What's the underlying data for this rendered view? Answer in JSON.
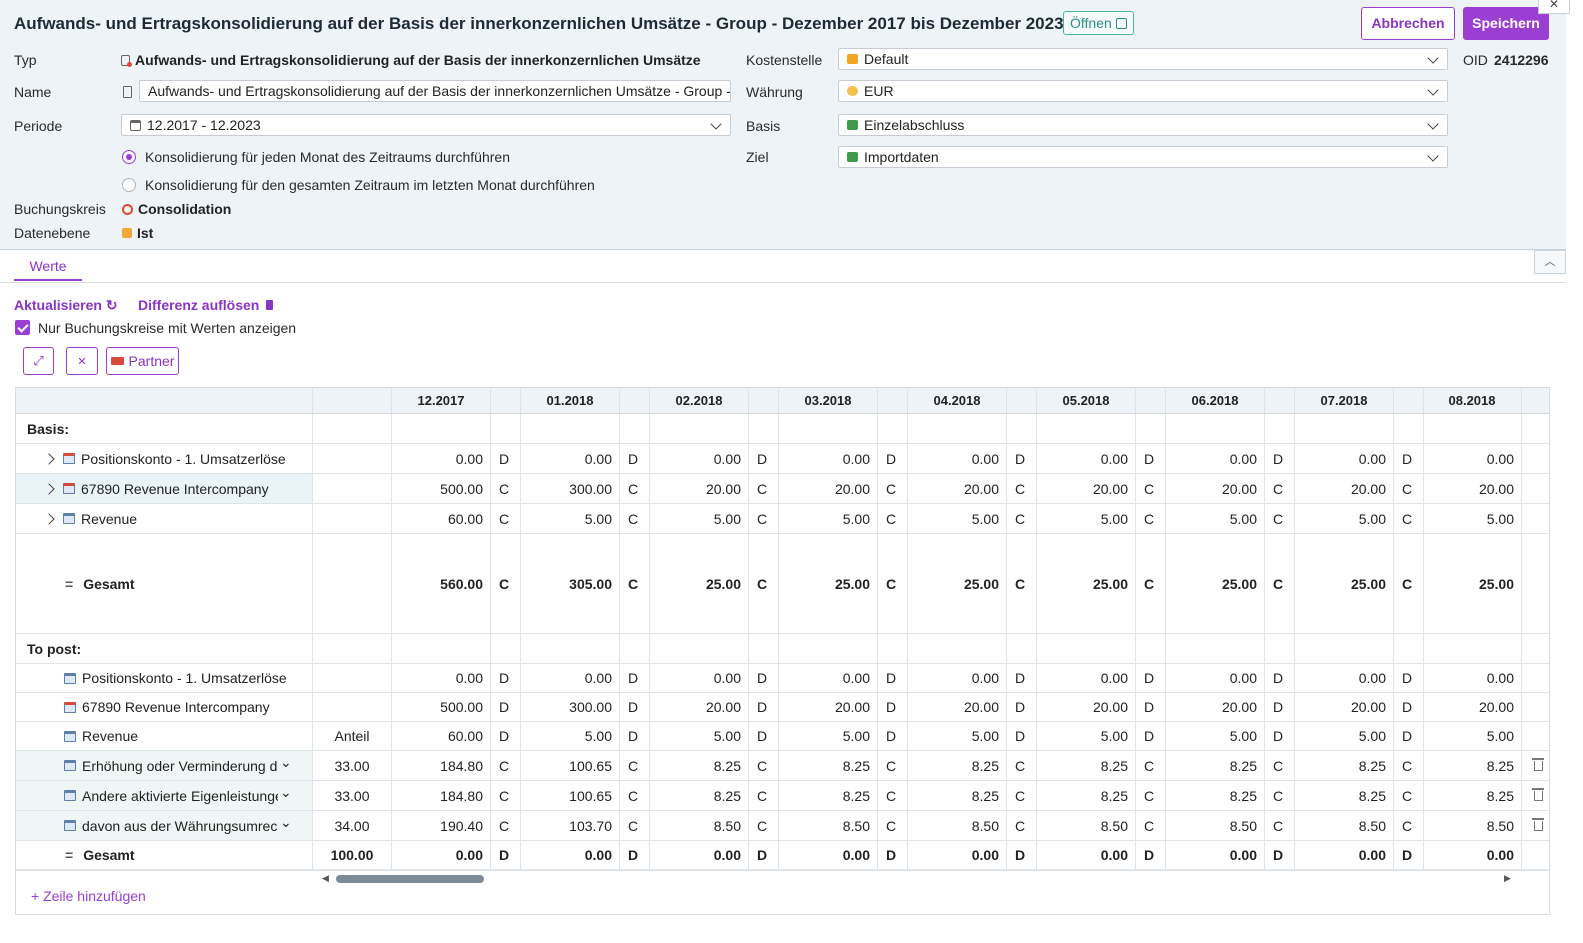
{
  "header": {
    "title": "Aufwands- und Ertragskonsolidierung auf der Basis der innerkonzernlichen Umsätze - Group - Dezember 2017 bis Dezember 2023",
    "open_label": "Öffnen",
    "cancel_label": "Abbrechen",
    "save_label": "Speichern",
    "close_glyph": "✕"
  },
  "form": {
    "type_label": "Typ",
    "type_value": "Aufwands- und Ertragskonsolidierung auf der Basis der innerkonzernlichen Umsätze",
    "name_label": "Name",
    "name_value": "Aufwands- und Ertragskonsolidierung auf der Basis der innerkonzernlichen Umsätze - Group -",
    "period_label": "Periode",
    "period_value": "12.2017 - 12.2023",
    "radio_monthly": "Konsolidierung für jeden Monat des Zeitraums durchführen",
    "radio_total": "Konsolidierung für den gesamten Zeitraum im letzten Monat durchführen",
    "booking_label": "Buchungskreis",
    "booking_value": "Consolidation",
    "data_level_label": "Datenebene",
    "data_level_value": "Ist",
    "cost_center_label": "Kostenstelle",
    "cost_center_value": "Default",
    "currency_label": "Währung",
    "currency_value": "EUR",
    "basis_label": "Basis",
    "basis_value": "Einzelabschluss",
    "target_label": "Ziel",
    "target_value": "Importdaten",
    "oid_label": "OID",
    "oid_value": "2412296"
  },
  "tabs": {
    "values_label": "Werte"
  },
  "actions": {
    "refresh_label": "Aktualisieren",
    "resolve_label": "Differenz auflösen",
    "only_with_values_label": "Nur Buchungskreise mit Werten anzeigen",
    "partner_label": "Partner",
    "add_row_label": "+ Zeile hinzufügen"
  },
  "table": {
    "months": [
      "12.2017",
      "01.2018",
      "02.2018",
      "03.2018",
      "04.2018",
      "05.2018",
      "06.2018",
      "07.2018",
      "08.2018"
    ],
    "basis_section_label": "Basis:",
    "to_post_section_label": "To post:",
    "basis_rows": [
      {
        "name": "Positionskonto - 1. Umsatzerlöse",
        "icon": "red",
        "expand": true,
        "share": "",
        "bold": false,
        "values": [
          "0.00",
          "0.00",
          "0.00",
          "0.00",
          "0.00",
          "0.00",
          "0.00",
          "0.00",
          "0.00"
        ],
        "dc": [
          "D",
          "D",
          "D",
          "D",
          "D",
          "D",
          "D",
          "D"
        ]
      },
      {
        "name": "67890 Revenue Intercompany",
        "icon": "red",
        "expand": true,
        "share": "",
        "bold": false,
        "hl": true,
        "values": [
          "500.00",
          "300.00",
          "20.00",
          "20.00",
          "20.00",
          "20.00",
          "20.00",
          "20.00",
          "20.00"
        ],
        "dc": [
          "C",
          "C",
          "C",
          "C",
          "C",
          "C",
          "C",
          "C"
        ]
      },
      {
        "name": "Revenue",
        "icon": "blue",
        "expand": true,
        "share": "",
        "bold": false,
        "values": [
          "60.00",
          "5.00",
          "5.00",
          "5.00",
          "5.00",
          "5.00",
          "5.00",
          "5.00",
          "5.00"
        ],
        "dc": [
          "C",
          "C",
          "C",
          "C",
          "C",
          "C",
          "C",
          "C"
        ]
      },
      {
        "name": "Gesamt",
        "eq": true,
        "share": "",
        "bold": true,
        "values": [
          "560.00",
          "305.00",
          "25.00",
          "25.00",
          "25.00",
          "25.00",
          "25.00",
          "25.00",
          "25.00"
        ],
        "dc": [
          "C",
          "C",
          "C",
          "C",
          "C",
          "C",
          "C",
          "C"
        ]
      }
    ],
    "post_rows": [
      {
        "name": "Positionskonto - 1. Umsatzerlöse",
        "icon": "blue",
        "share": "",
        "values": [
          "0.00",
          "0.00",
          "0.00",
          "0.00",
          "0.00",
          "0.00",
          "0.00",
          "0.00",
          "0.00"
        ],
        "dc": [
          "D",
          "D",
          "D",
          "D",
          "D",
          "D",
          "D",
          "D"
        ]
      },
      {
        "name": "67890 Revenue Intercompany",
        "icon": "red",
        "share": "",
        "values": [
          "500.00",
          "300.00",
          "20.00",
          "20.00",
          "20.00",
          "20.00",
          "20.00",
          "20.00",
          "20.00"
        ],
        "dc": [
          "D",
          "D",
          "D",
          "D",
          "D",
          "D",
          "D",
          "D"
        ]
      },
      {
        "name": "Revenue",
        "icon": "blue",
        "share": "Anteil",
        "values": [
          "60.00",
          "5.00",
          "5.00",
          "5.00",
          "5.00",
          "5.00",
          "5.00",
          "5.00",
          "5.00"
        ],
        "dc": [
          "D",
          "D",
          "D",
          "D",
          "D",
          "D",
          "D",
          "D"
        ]
      },
      {
        "name": "Erhöhung oder Verminderung des",
        "icon": "blue",
        "select": true,
        "tinted": true,
        "trash": true,
        "share": "33.00",
        "values": [
          "184.80",
          "100.65",
          "8.25",
          "8.25",
          "8.25",
          "8.25",
          "8.25",
          "8.25",
          "8.25"
        ],
        "dc": [
          "C",
          "C",
          "C",
          "C",
          "C",
          "C",
          "C",
          "C"
        ]
      },
      {
        "name": "Andere aktivierte Eigenleistungen",
        "icon": "blue",
        "select": true,
        "tinted": true,
        "trash": true,
        "share": "33.00",
        "values": [
          "184.80",
          "100.65",
          "8.25",
          "8.25",
          "8.25",
          "8.25",
          "8.25",
          "8.25",
          "8.25"
        ],
        "dc": [
          "C",
          "C",
          "C",
          "C",
          "C",
          "C",
          "C",
          "C"
        ]
      },
      {
        "name": "davon aus der Währungsumrechnung",
        "icon": "blue",
        "select": true,
        "tinted": true,
        "trash": true,
        "share": "34.00",
        "values": [
          "190.40",
          "103.70",
          "8.50",
          "8.50",
          "8.50",
          "8.50",
          "8.50",
          "8.50",
          "8.50"
        ],
        "dc": [
          "C",
          "C",
          "C",
          "C",
          "C",
          "C",
          "C",
          "C"
        ]
      },
      {
        "name": "Gesamt",
        "eq": true,
        "bold": true,
        "share": "100.00",
        "values": [
          "0.00",
          "0.00",
          "0.00",
          "0.00",
          "0.00",
          "0.00",
          "0.00",
          "0.00",
          "0.00"
        ],
        "dc": [
          "D",
          "D",
          "D",
          "D",
          "D",
          "D",
          "D",
          "D"
        ]
      }
    ]
  },
  "colors": {
    "accent": "#9b3fd3",
    "header_bg": "#eef3f7",
    "teal": "#4bb3a8"
  }
}
